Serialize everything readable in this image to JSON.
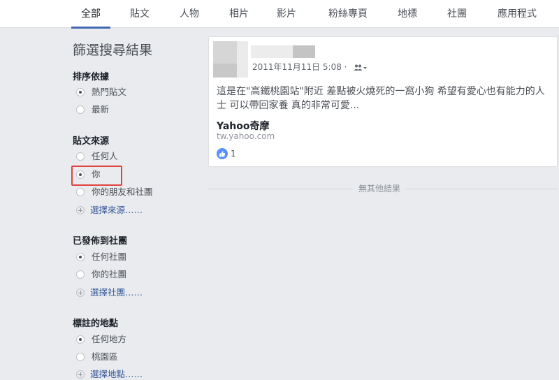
{
  "tabs": [
    {
      "label": "全部",
      "active": true
    },
    {
      "label": "貼文"
    },
    {
      "label": "人物"
    },
    {
      "label": "相片"
    },
    {
      "label": "影片"
    },
    {
      "label": "粉絲專頁"
    },
    {
      "label": "地標"
    },
    {
      "label": "社團"
    },
    {
      "label": "應用程式"
    }
  ],
  "filters": {
    "title": "篩選搜尋結果",
    "sort": {
      "heading": "排序依據",
      "options": [
        {
          "label": "熱門貼文",
          "selected": true
        },
        {
          "label": "最新",
          "selected": false
        }
      ]
    },
    "source": {
      "heading": "貼文來源",
      "options": [
        {
          "label": "任何人",
          "selected": false
        },
        {
          "label": "你",
          "selected": true
        },
        {
          "label": "你的朋友和社團",
          "selected": false
        }
      ],
      "choose": "選擇來源……"
    },
    "group": {
      "heading": "已發佈到社團",
      "options": [
        {
          "label": "任何社團",
          "selected": true
        },
        {
          "label": "你的社團",
          "selected": false
        }
      ],
      "choose": "選擇社團……"
    },
    "location": {
      "heading": "標註的地點",
      "options": [
        {
          "label": "任何地方",
          "selected": true
        },
        {
          "label": "桃園區",
          "selected": false
        }
      ],
      "choose": "選擇地點……"
    }
  },
  "post": {
    "timestamp": "2011年11月11日 5:08 ·",
    "text": "這是在\"高鐵桃園站\"附近 差點被火燒死的一窩小狗 希望有愛心也有能力的人士 可以帶回家養 真的非常可愛...",
    "link_title": "Yahoo奇摩",
    "link_domain": "tw.yahoo.com",
    "like_count": "1"
  },
  "no_more": "無其他結果",
  "colors": {
    "accent": "#4267b2",
    "highlight": "#e0443f",
    "like": "#5890ff"
  }
}
